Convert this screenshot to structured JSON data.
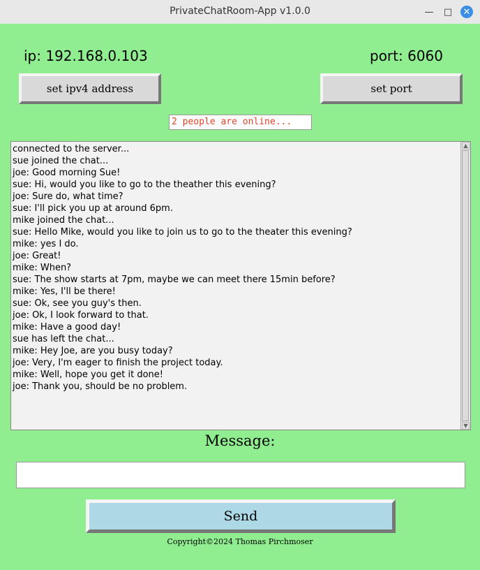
{
  "window": {
    "title": "PrivateChatRoom-App v1.0.0",
    "controls": {
      "minimize": "—",
      "maximize": "□",
      "close": "✕"
    }
  },
  "connection": {
    "ip_label": "ip: 192.168.0.103",
    "port_label": "port: 6060",
    "set_ip_button": "set ipv4 address",
    "set_port_button": "set port"
  },
  "status": {
    "online_text": "2 people are online..."
  },
  "chat": {
    "lines": [
      "connected to the server...",
      "sue joined the chat...",
      "joe: Good morning Sue!",
      "sue: Hi, would you like to go to the theather this evening?",
      "joe: Sure do, what time?",
      "sue: I'll pick you up at around 6pm.",
      "mike joined the chat...",
      "sue: Hello Mike, would you like to join us to go to the theater this evening?",
      "mike: yes I do.",
      "joe: Great!",
      "mike: When?",
      "sue: The show starts at 7pm, maybe we can meet there 15min before?",
      "mike: Yes, I'll be there!",
      "sue: Ok, see you guy's then.",
      "joe: Ok, I look forward to that.",
      "mike: Have a good day!",
      "sue has left the chat...",
      "mike: Hey Joe, are you busy today?",
      "joe: Very, I'm eager to finish the project today.",
      "mike: Well, hope you get it done!",
      "joe: Thank you, should be no problem."
    ]
  },
  "message": {
    "label": "Message:",
    "value": "",
    "send_button": "Send"
  },
  "footer": {
    "copyright": "Copyright©2024 Thomas Pirchmoser"
  },
  "colors": {
    "background": "#90ee90",
    "send_button": "#add8e6",
    "status_text": "#e0442a",
    "close_button": "#3a8ee6"
  }
}
